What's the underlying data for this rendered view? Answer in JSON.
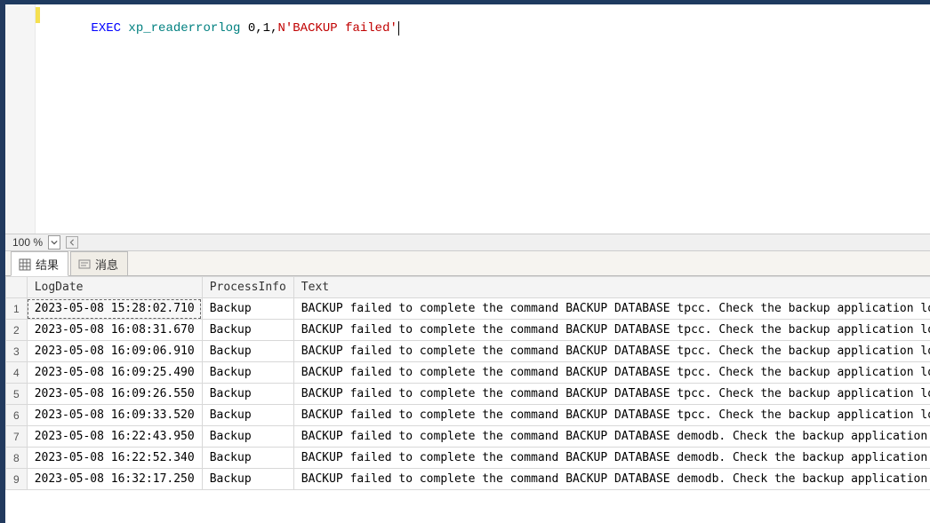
{
  "editor": {
    "sql": {
      "kw_exec": "EXEC",
      "proc": " xp_readerrorlog ",
      "args_pre": "0,1,",
      "str": "N'BACKUP failed'"
    }
  },
  "zoom": {
    "value": "100 %"
  },
  "tabs": {
    "results": "结果",
    "messages": "消息"
  },
  "grid": {
    "headers": {
      "logdate": "LogDate",
      "process": "ProcessInfo",
      "text": "Text"
    },
    "rows": [
      {
        "n": "1",
        "logdate": "2023-05-08 15:28:02.710",
        "process": "Backup",
        "text": "BACKUP failed to complete the command BACKUP DATABASE tpcc. Check the backup application log"
      },
      {
        "n": "2",
        "logdate": "2023-05-08 16:08:31.670",
        "process": "Backup",
        "text": "BACKUP failed to complete the command BACKUP DATABASE tpcc. Check the backup application log"
      },
      {
        "n": "3",
        "logdate": "2023-05-08 16:09:06.910",
        "process": "Backup",
        "text": "BACKUP failed to complete the command BACKUP DATABASE tpcc. Check the backup application log"
      },
      {
        "n": "4",
        "logdate": "2023-05-08 16:09:25.490",
        "process": "Backup",
        "text": "BACKUP failed to complete the command BACKUP DATABASE tpcc. Check the backup application log"
      },
      {
        "n": "5",
        "logdate": "2023-05-08 16:09:26.550",
        "process": "Backup",
        "text": "BACKUP failed to complete the command BACKUP DATABASE tpcc. Check the backup application log"
      },
      {
        "n": "6",
        "logdate": "2023-05-08 16:09:33.520",
        "process": "Backup",
        "text": "BACKUP failed to complete the command BACKUP DATABASE tpcc. Check the backup application log"
      },
      {
        "n": "7",
        "logdate": "2023-05-08 16:22:43.950",
        "process": "Backup",
        "text": "BACKUP failed to complete the command BACKUP DATABASE demodb. Check the backup application l"
      },
      {
        "n": "8",
        "logdate": "2023-05-08 16:22:52.340",
        "process": "Backup",
        "text": "BACKUP failed to complete the command BACKUP DATABASE demodb. Check the backup application l"
      },
      {
        "n": "9",
        "logdate": "2023-05-08 16:32:17.250",
        "process": "Backup",
        "text": "BACKUP failed to complete the command BACKUP DATABASE demodb. Check the backup application l"
      }
    ]
  }
}
